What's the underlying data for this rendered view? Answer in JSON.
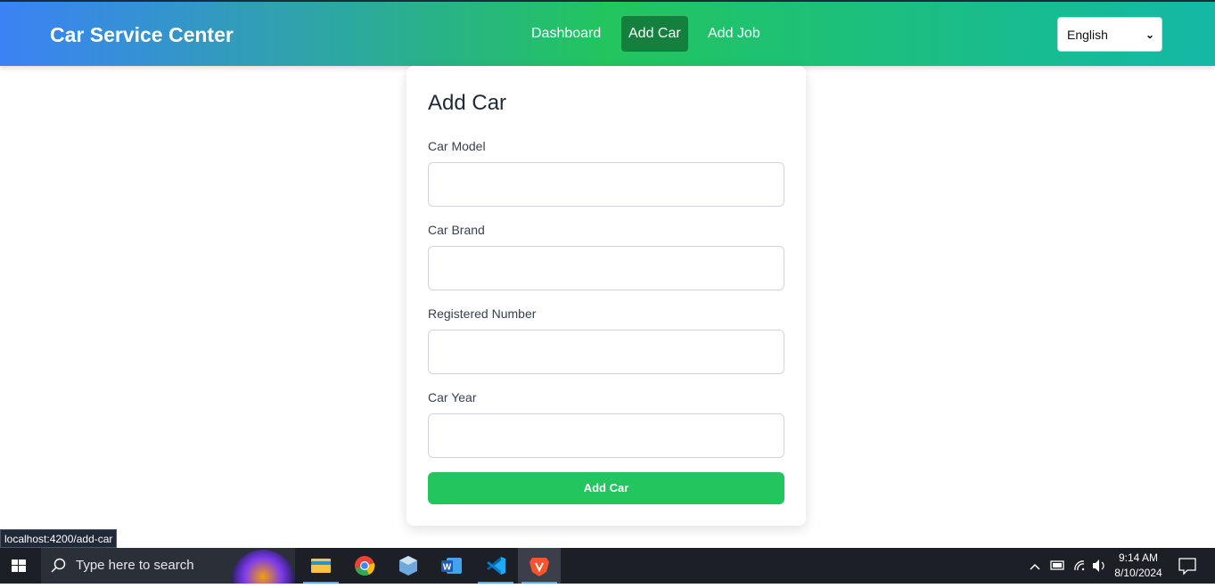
{
  "header": {
    "brand": "Car Service Center",
    "nav": [
      "Dashboard",
      "Add Car",
      "Add Job"
    ],
    "active_nav": "Add Car",
    "language": "English"
  },
  "form": {
    "title": "Add Car",
    "fields": [
      {
        "label": "Car Model",
        "value": ""
      },
      {
        "label": "Car Brand",
        "value": ""
      },
      {
        "label": "Registered Number",
        "value": ""
      },
      {
        "label": "Car Year",
        "value": ""
      }
    ],
    "submit": "Add Car"
  },
  "status_bar": {
    "url": "localhost:4200/add-car"
  },
  "taskbar": {
    "search_placeholder": "Type here to search",
    "apps": [
      "file-explorer-icon",
      "chrome-icon",
      "virtualbox-icon",
      "word-icon",
      "vscode-icon",
      "brave-icon"
    ],
    "time": "9:14 AM",
    "date": "8/10/2024"
  },
  "colors": {
    "accent": "#22c55e",
    "active_nav": "#15803d",
    "gradient_start": "#3b82f6",
    "gradient_end": "#14b8a6"
  }
}
